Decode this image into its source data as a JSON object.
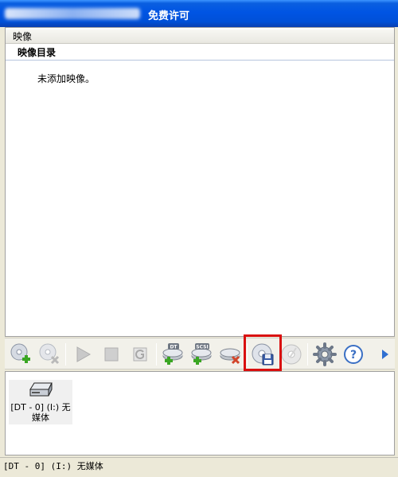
{
  "window": {
    "title": "免费许可"
  },
  "images_panel": {
    "group_label": "映像",
    "catalog_label": "映像目录",
    "empty_message": "未添加映像。"
  },
  "toolbar": {
    "buttons": [
      {
        "icon": "add-image-icon",
        "enabled": true
      },
      {
        "icon": "remove-image-icon",
        "enabled": false
      },
      {
        "icon": "play-icon",
        "enabled": false
      },
      {
        "icon": "stop-icon",
        "enabled": false
      },
      {
        "icon": "g-icon",
        "enabled": false
      },
      {
        "icon": "add-dt-drive-icon",
        "enabled": true,
        "badge": "DT"
      },
      {
        "icon": "add-scsi-drive-icon",
        "enabled": true,
        "badge": "SCSI"
      },
      {
        "icon": "remove-drive-icon",
        "enabled": true
      },
      {
        "icon": "save-image-icon",
        "enabled": true,
        "highlighted": true
      },
      {
        "icon": "burn-disc-icon",
        "enabled": false
      },
      {
        "icon": "settings-icon",
        "enabled": true
      },
      {
        "icon": "help-icon",
        "enabled": true
      },
      {
        "icon": "more-arrow-icon",
        "enabled": true
      }
    ]
  },
  "drives": [
    {
      "label": "[DT - 0] (I:) 无媒体"
    }
  ],
  "status": {
    "text": "[DT - 0] (I:) 无媒体"
  },
  "colors": {
    "titlebar": "#0054e3",
    "highlight_border": "#d90f0f",
    "add_green": "#3aa623",
    "remove_red": "#d2452b"
  }
}
